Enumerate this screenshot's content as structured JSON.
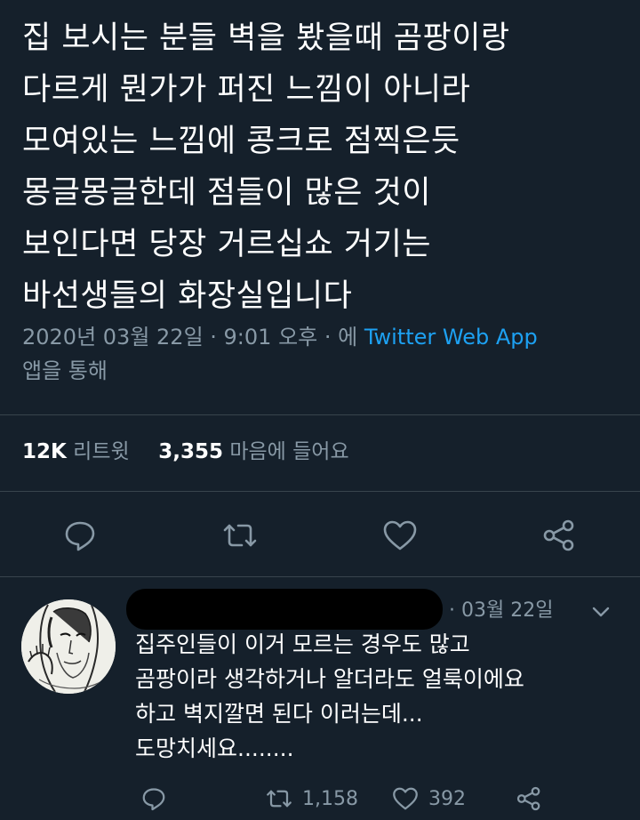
{
  "tweet": {
    "lines": [
      "집 보시는 분들 벽을 봤을때 곰팡이랑",
      "다르게 뭔가가 퍼진 느낌이 아니라",
      "모여있는 느낌에 콩크로 점찍은듯",
      "몽글몽글한데 점들이 많은 것이",
      "보인다면 당장 거르십쇼 거기는",
      "바선생들의 화장실입니다"
    ],
    "meta_prefix": "2020년 03월 22일 · 9:01 오후 · 에 ",
    "source": "Twitter Web App",
    "meta_suffix": "앱을 통해",
    "retweet_count": "12K",
    "retweet_label": "리트윗",
    "like_count": "3,355",
    "like_label": "마음에 들어요"
  },
  "actions": {
    "reply_icon": "reply-icon",
    "retweet_icon": "retweet-icon",
    "like_icon": "heart-icon",
    "share_icon": "share-icon"
  },
  "reply": {
    "date": "· 03월 22일",
    "lines": [
      "집주인들이 이거 모르는 경우도 많고",
      "곰팡이라 생각하거나 알더라도 얼룩이에요",
      "하고 벽지깔면 된다 이러는데...",
      "도망치세요........"
    ],
    "retweet_count": "1,158",
    "like_count": "392"
  },
  "colors": {
    "background": "#15202b",
    "text": "#ffffff",
    "secondary": "#8899a6",
    "accent": "#1da1f2",
    "divider": "#38444d"
  }
}
